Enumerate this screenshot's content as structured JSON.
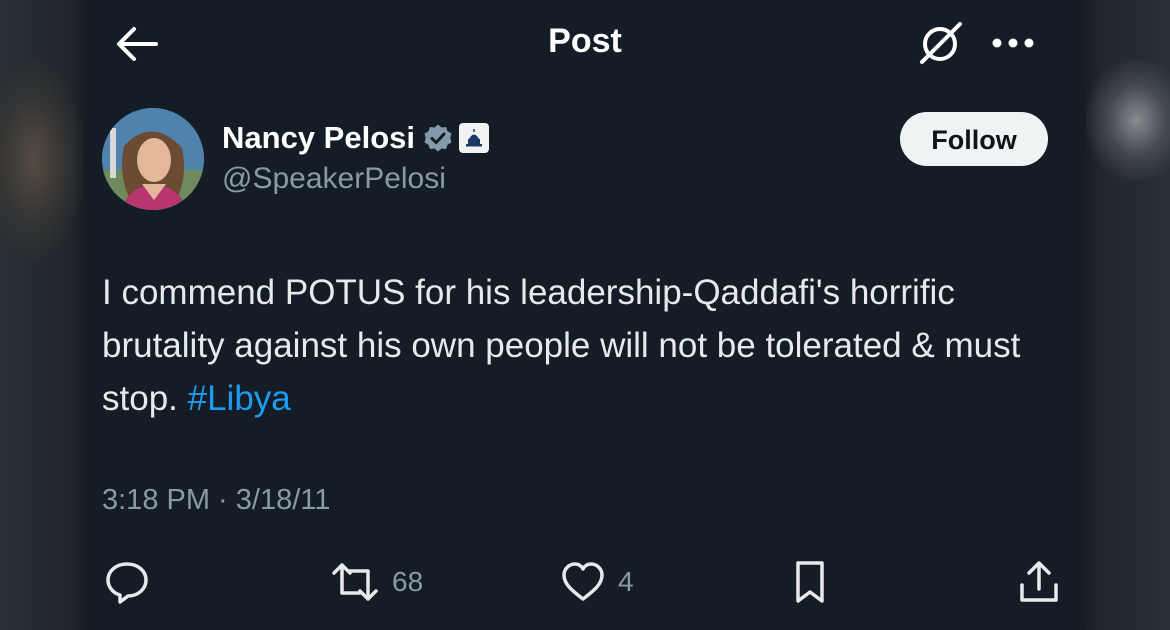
{
  "header": {
    "title": "Post",
    "back_icon": "arrow-left-icon",
    "grok_icon": "grok-icon",
    "more_icon": "more-dots-icon"
  },
  "author": {
    "display_name": "Nancy Pelosi",
    "handle": "@SpeakerPelosi",
    "verified_icon": "verified-badge-icon",
    "affiliation_icon": "capitol-affiliation-icon"
  },
  "follow_button": {
    "label": "Follow"
  },
  "tweet": {
    "text": "I commend POTUS for his leadership-Qaddafi's horrific brutality against his own people will not be tolerated & must stop.",
    "hashtag": "#Libya",
    "timestamp": "3:18 PM · 3/18/11"
  },
  "actions": {
    "reply": {
      "icon": "reply-icon",
      "count": ""
    },
    "repost": {
      "icon": "repost-icon",
      "count": "68"
    },
    "like": {
      "icon": "heart-icon",
      "count": "4"
    },
    "bookmark": {
      "icon": "bookmark-icon",
      "count": ""
    },
    "share": {
      "icon": "share-icon",
      "count": ""
    }
  },
  "colors": {
    "background": "#141d26",
    "text": "#e7e9ea",
    "muted": "#8b98a5",
    "link": "#1d9bf0",
    "verified": "#829aab"
  }
}
